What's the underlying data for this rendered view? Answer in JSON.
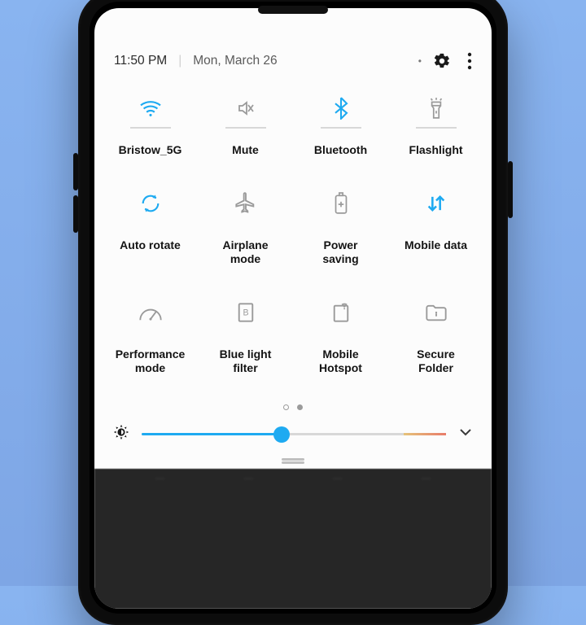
{
  "status": {
    "time": "11:50 PM",
    "date": "Mon, March 26"
  },
  "colors": {
    "accent": "#1eaaf1",
    "muted": "#9a9a9a"
  },
  "tiles": [
    {
      "id": "wifi",
      "label": "Bristow_5G",
      "active": true
    },
    {
      "id": "mute",
      "label": "Mute",
      "active": false
    },
    {
      "id": "bluetooth",
      "label": "Bluetooth",
      "active": true
    },
    {
      "id": "flashlight",
      "label": "Flashlight",
      "active": false
    },
    {
      "id": "autorotate",
      "label": "Auto rotate",
      "active": true
    },
    {
      "id": "airplane",
      "label": "Airplane mode",
      "active": false
    },
    {
      "id": "powersaving",
      "label": "Power saving",
      "active": false
    },
    {
      "id": "mobiledata",
      "label": "Mobile data",
      "active": true
    },
    {
      "id": "perfmode",
      "label": "Performance mode",
      "active": false
    },
    {
      "id": "bluelight",
      "label": "Blue light filter",
      "active": false
    },
    {
      "id": "hotspot",
      "label": "Mobile Hotspot",
      "active": false
    },
    {
      "id": "secure",
      "label": "Secure Folder",
      "active": false
    }
  ],
  "pager": {
    "current": 1,
    "total": 2
  },
  "brightness": {
    "percent": 46
  }
}
